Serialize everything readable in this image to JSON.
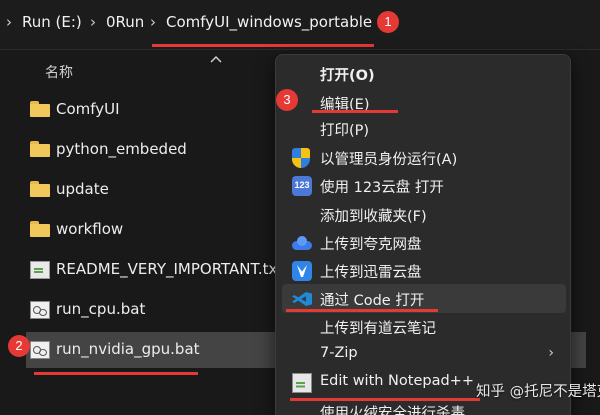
{
  "address_bar": {
    "breadcrumbs": [
      "Run (E:)",
      "0Run",
      "ComfyUI_windows_portable"
    ]
  },
  "file_list": {
    "column_header": "名称",
    "items": [
      {
        "name": "ComfyUI",
        "type": "folder"
      },
      {
        "name": "python_embeded",
        "type": "folder"
      },
      {
        "name": "update",
        "type": "folder"
      },
      {
        "name": "workflow",
        "type": "folder"
      },
      {
        "name": "README_VERY_IMPORTANT.txt",
        "type": "text-file"
      },
      {
        "name": "run_cpu.bat",
        "type": "batch-file"
      },
      {
        "name": "run_nvidia_gpu.bat",
        "type": "batch-file",
        "selected": true
      }
    ]
  },
  "annotations": [
    "1",
    "2",
    "3"
  ],
  "context_menu": {
    "items": [
      {
        "label": "打开(O)"
      },
      {
        "label": "编辑(E)"
      },
      {
        "label": "打印(P)"
      },
      {
        "label": "以管理员身份运行(A)",
        "icon": "uac-shield-icon"
      },
      {
        "label": "使用 123云盘 打开",
        "icon": "123-cloud-icon",
        "icon_text": "123"
      },
      {
        "label": "添加到收藏夹(F)"
      },
      {
        "label": "上传到夸克网盘",
        "icon": "quark-cloud-icon"
      },
      {
        "label": "上传到迅雷云盘",
        "icon": "xunlei-icon"
      },
      {
        "label": "通过 Code 打开",
        "icon": "vscode-icon",
        "highlighted": true
      },
      {
        "label": "上传到有道云笔记"
      },
      {
        "label": "7-Zip",
        "has_submenu": true
      },
      {
        "label": "Edit with Notepad++",
        "icon": "notepad-plus-plus-icon"
      },
      {
        "label": "使用火绒安全进行杀毒"
      }
    ]
  },
  "watermark": "知乎 @托尼不是塔克",
  "colors": {
    "annotation_red": "#e53935",
    "selection": "#444444",
    "menu_background": "#2b2b2b"
  }
}
